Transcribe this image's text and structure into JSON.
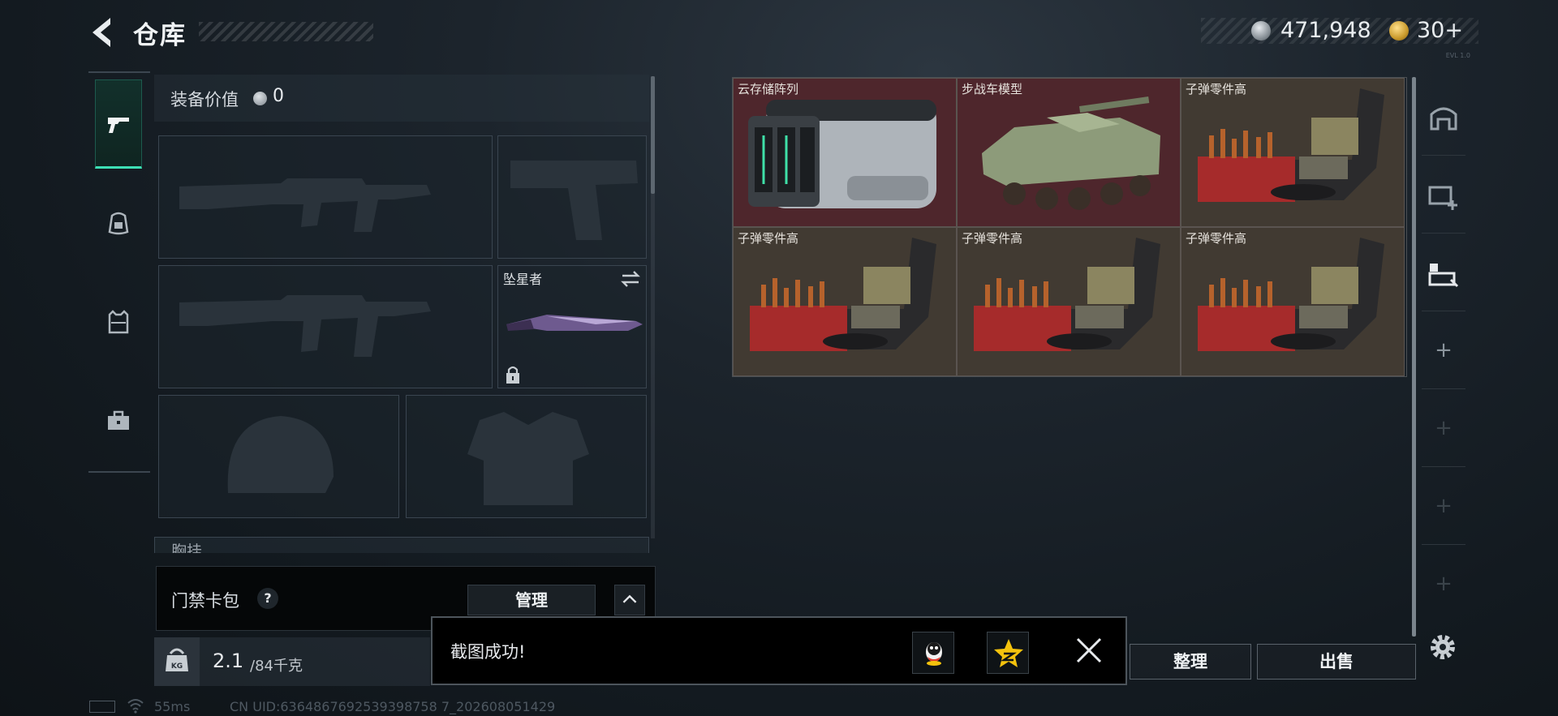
{
  "header": {
    "title": "仓库",
    "currency_silver": "471,948",
    "currency_gold": "30+",
    "version_tiny": "EVL 1.0"
  },
  "left_nav": {
    "items": [
      "weapons-icon",
      "backpack-icon",
      "vest-icon",
      "toolbox-icon"
    ],
    "active_index": 0
  },
  "equipment": {
    "value_label": "装备价值",
    "value": "0",
    "slots": {
      "primary_1": "empty",
      "pistol": "empty",
      "primary_2": "empty",
      "melee_name": "坠星者",
      "helmet": "empty",
      "armor": "empty"
    },
    "chest_rig_label": "胸挂"
  },
  "keycard": {
    "label": "门禁卡包",
    "help": "?",
    "manage_button": "管理"
  },
  "weight": {
    "current": "2.1",
    "max": "/84千克",
    "icon_text": "KG"
  },
  "status_bar": {
    "ping": "55ms",
    "uid": "CN UID:6364867692539398758 7_202608051429"
  },
  "storage": {
    "items": [
      {
        "label": "云存储阵列",
        "bg": "red"
      },
      {
        "label": "步战车模型",
        "bg": "red"
      },
      {
        "label": "子弹零件高",
        "bg": "brown"
      },
      {
        "label": "子弹零件高",
        "bg": "brown"
      },
      {
        "label": "子弹零件高",
        "bg": "brown"
      },
      {
        "label": "子弹零件高",
        "bg": "brown"
      }
    ]
  },
  "right_nav": {
    "items": [
      "home-icon",
      "add-storage-icon",
      "expand-storage-icon",
      "plus",
      "plus",
      "plus",
      "plus"
    ]
  },
  "actions": {
    "sort": "整理",
    "sell": "出售"
  },
  "toast": {
    "message": "截图成功!",
    "share_qq": "qq-icon",
    "share_qzone": "qzone-star-icon"
  },
  "colors": {
    "accent": "#3de0b5",
    "item_red": "#4e262c",
    "item_brown": "#413a32"
  }
}
